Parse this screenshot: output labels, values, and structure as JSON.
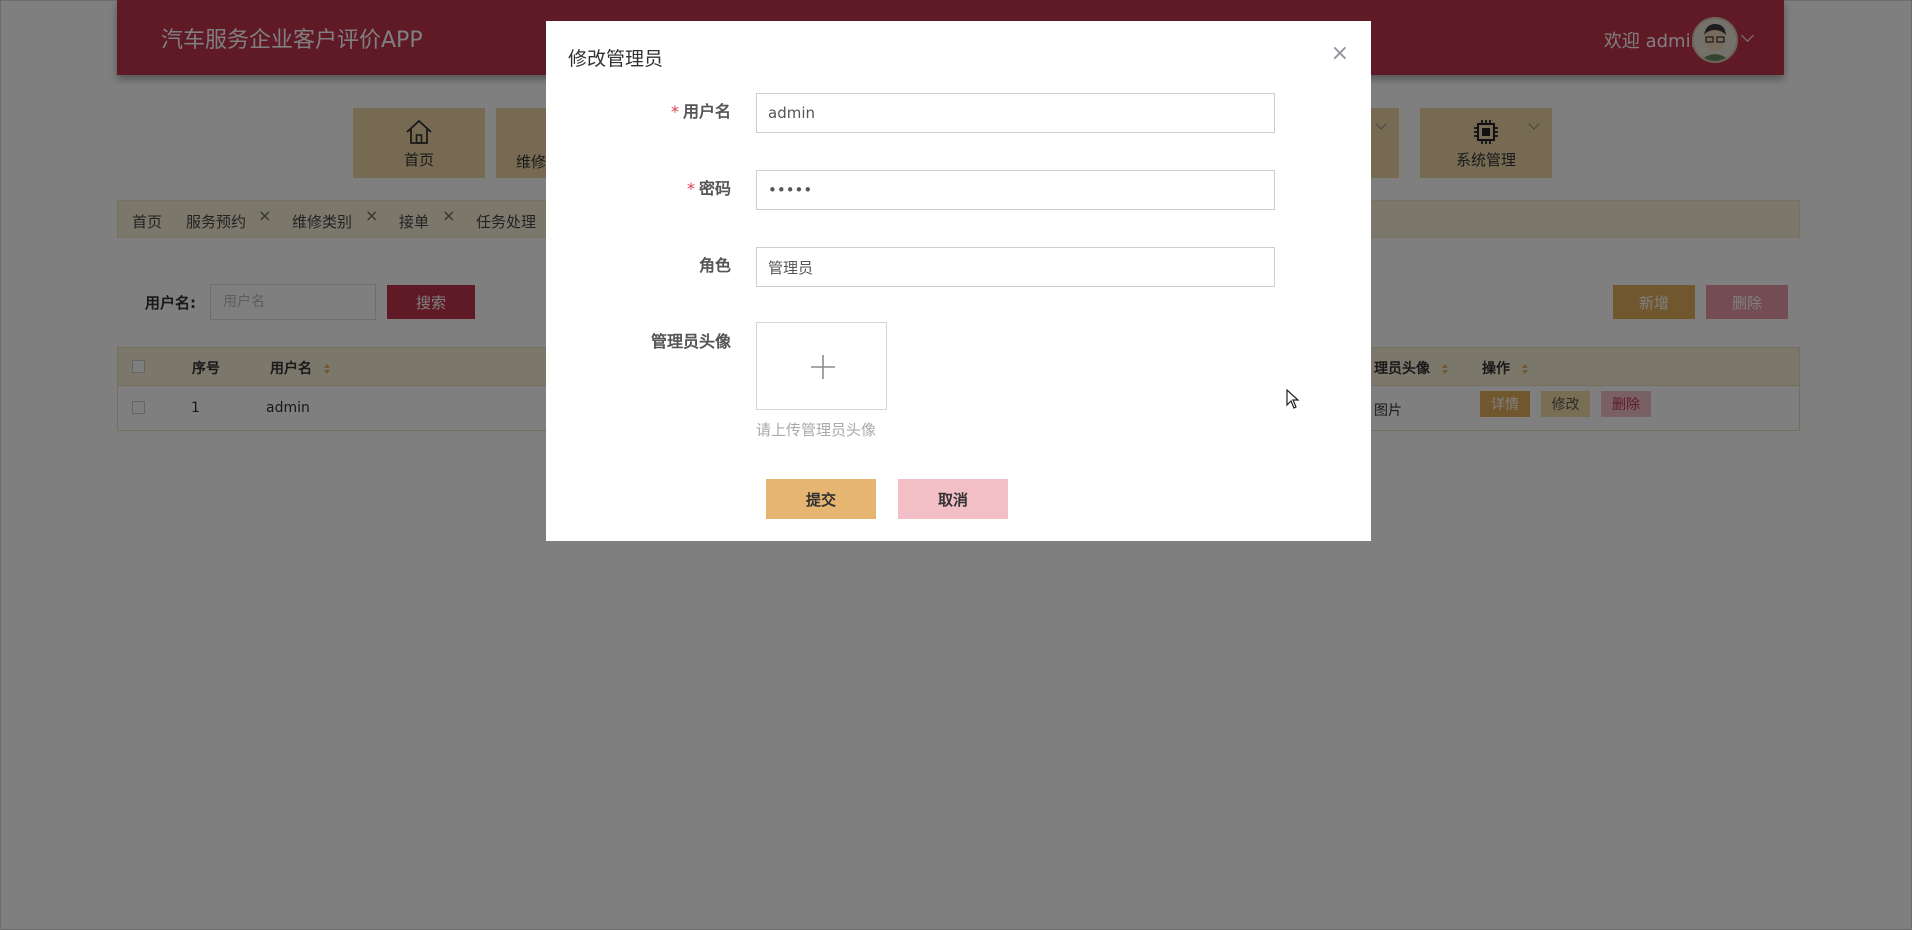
{
  "header": {
    "app_title": "汽车服务企业客户评价APP",
    "welcome": "欢迎 admin"
  },
  "nav": {
    "items": [
      {
        "label": "首页",
        "icon": "home-icon"
      },
      {
        "label": "维修",
        "icon": "wrench-icon"
      },
      {
        "label": "",
        "icon": "chevron-down-icon"
      },
      {
        "label": "系统管理",
        "icon": "chip-icon"
      }
    ]
  },
  "tabs": [
    {
      "label": "首页"
    },
    {
      "label": "服务预约",
      "close": "×"
    },
    {
      "label": "维修类别",
      "close": "×"
    },
    {
      "label": "接单",
      "close": "×"
    },
    {
      "label": "任务处理"
    }
  ],
  "search": {
    "label": "用户名:",
    "placeholder": "用户名",
    "button": "搜索"
  },
  "actions": {
    "add": "新增",
    "delete": "删除"
  },
  "table": {
    "columns": [
      "序号",
      "用户名",
      "理员头像",
      "操作"
    ],
    "rows": [
      {
        "index": "1",
        "username": "admin",
        "avatar_text": "图片"
      }
    ],
    "row_actions": {
      "detail": "详情",
      "edit": "修改",
      "delete": "删除"
    }
  },
  "dialog": {
    "title": "修改管理员",
    "close": "×",
    "fields": {
      "username": {
        "label": "用户名",
        "value": "admin",
        "required": "*"
      },
      "password": {
        "label": "密码",
        "value": "•••••",
        "required": "*"
      },
      "role": {
        "label": "角色",
        "value": "管理员"
      },
      "avatar": {
        "label": "管理员头像",
        "hint": "请上传管理员头像"
      }
    },
    "submit": "提交",
    "cancel": "取消"
  },
  "colors": {
    "brand": "#c0354a",
    "nav_bg": "#ecd7a4",
    "accent_gold": "#e2ae5c",
    "accent_pink": "#e99aa8"
  }
}
